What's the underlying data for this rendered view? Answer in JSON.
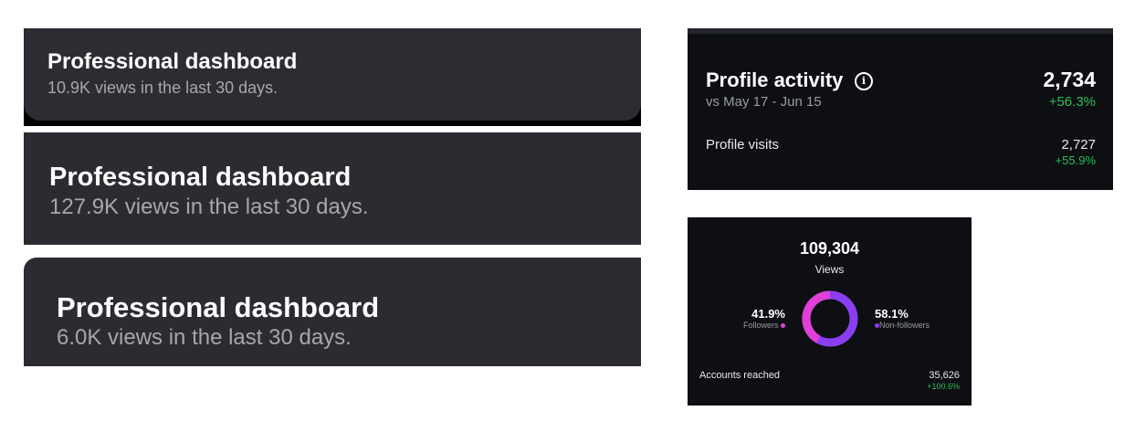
{
  "dashboards": [
    {
      "title": "Professional dashboard",
      "subtitle": "10.9K views in the last 30 days."
    },
    {
      "title": "Professional dashboard",
      "subtitle": "127.9K views in the last 30 days."
    },
    {
      "title": "Professional dashboard",
      "subtitle": "6.0K views in the last 30 days."
    }
  ],
  "profile_activity": {
    "title": "Profile activity",
    "info_icon": "info-circle-icon",
    "date_range": "vs May 17 - Jun 15",
    "total": "2,734",
    "total_change": "+56.3%",
    "visits_label": "Profile visits",
    "visits_value": "2,727",
    "visits_change": "+55.9%"
  },
  "views": {
    "total": "109,304",
    "label": "Views",
    "followers_pct": "41.9%",
    "followers_label": "Followers",
    "non_followers_pct": "58.1%",
    "non_followers_label": "Non-followers",
    "followers_fraction": 0.419,
    "accounts_reached_label": "Accounts reached",
    "accounts_reached_value": "35,626",
    "accounts_reached_change": "+100.6%"
  },
  "colors": {
    "followers": "#e040d8",
    "non_followers": "#8a3ef0",
    "positive": "#2ebd59"
  }
}
